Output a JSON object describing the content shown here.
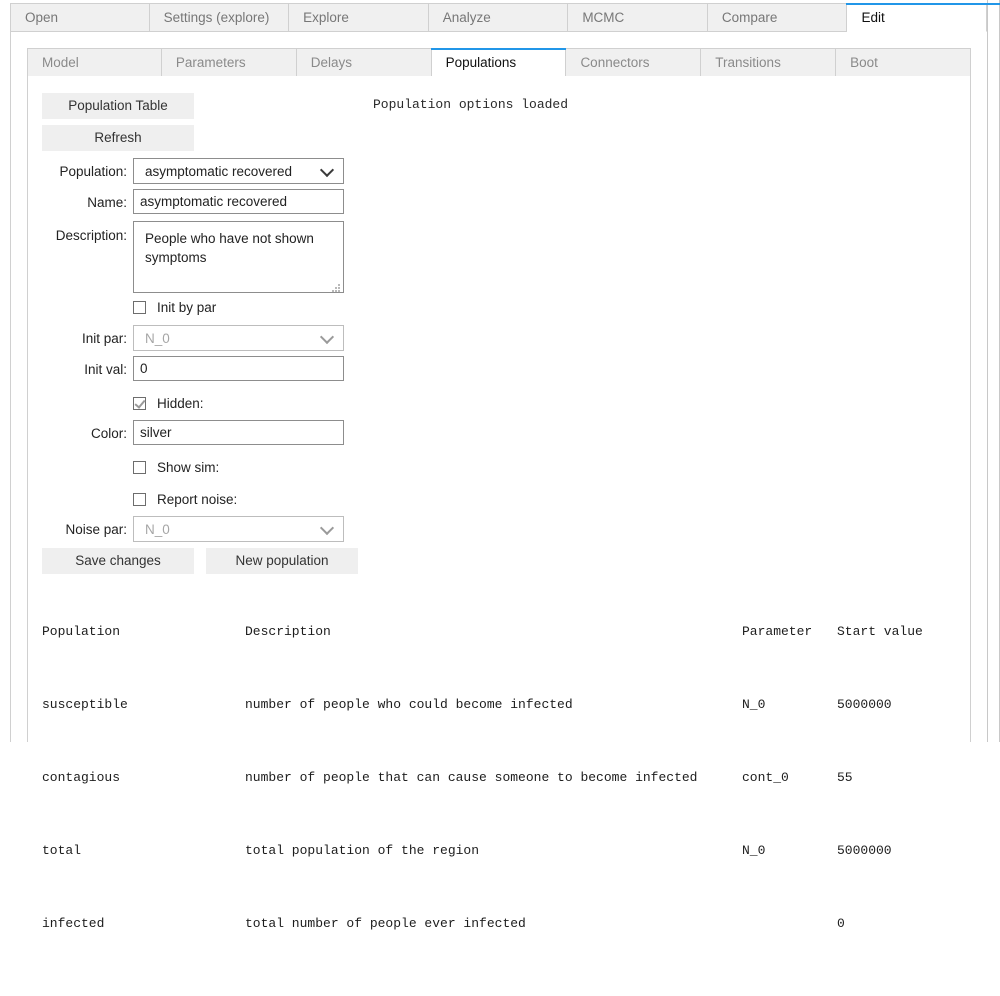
{
  "window": {
    "accent_color": "#2196e8",
    "tab_bg": "#f0f0f0",
    "button_bg": "#efefef"
  },
  "outer_tabs": [
    {
      "label": "Open",
      "active": false
    },
    {
      "label": "Settings (explore)",
      "active": false
    },
    {
      "label": "Explore",
      "active": false
    },
    {
      "label": "Analyze",
      "active": false
    },
    {
      "label": "MCMC",
      "active": false
    },
    {
      "label": "Compare",
      "active": false
    },
    {
      "label": "Edit",
      "active": true
    }
  ],
  "inner_tabs": [
    {
      "label": "Model",
      "active": false
    },
    {
      "label": "Parameters",
      "active": false
    },
    {
      "label": "Delays",
      "active": false
    },
    {
      "label": "Populations",
      "active": true
    },
    {
      "label": "Connectors",
      "active": false
    },
    {
      "label": "Transitions",
      "active": false
    },
    {
      "label": "Boot",
      "active": false
    }
  ],
  "status": {
    "message": "Population options loaded"
  },
  "form": {
    "population_table_button": "Population Table",
    "refresh_button": "Refresh",
    "population_label": "Population:",
    "population_value": "asymptomatic recovered",
    "name_label": "Name:",
    "name_value": "asymptomatic recovered",
    "description_label": "Description:",
    "description_value": "People who have not shown symptoms",
    "init_by_par_label": "Init by par",
    "init_by_par_checked": false,
    "init_par_label": "Init par:",
    "init_par_value": "N_0",
    "init_par_disabled": true,
    "init_val_label": "Init val:",
    "init_val_value": "0",
    "hidden_label": "Hidden:",
    "hidden_checked": true,
    "color_label": "Color:",
    "color_value": "silver",
    "show_sim_label": "Show sim:",
    "show_sim_checked": false,
    "report_noise_label": "Report noise:",
    "report_noise_checked": false,
    "noise_par_label": "Noise par:",
    "noise_par_value": "N_0",
    "noise_par_disabled": true,
    "save_changes_button": "Save changes",
    "new_population_button": "New population"
  },
  "table": {
    "headers": {
      "population": "Population",
      "description": "Description",
      "parameter": "Parameter",
      "start_value": "Start value"
    },
    "double_rule": "================================================================================================================",
    "single_rule": "----------------------------------------------------------------------------------------------------------------",
    "rows": [
      {
        "population": "susceptible",
        "description": "number of people who could become infected",
        "parameter": "N_0",
        "start_value": "5000000"
      },
      {
        "population": "contagious",
        "description": "number of people that can cause someone to become infected",
        "parameter": "cont_0",
        "start_value": "55"
      },
      {
        "population": "total",
        "description": "total population of the region",
        "parameter": "N_0",
        "start_value": "5000000"
      },
      {
        "population": "infected",
        "description": "total number of people ever infected",
        "parameter": "",
        "start_value": "0"
      }
    ]
  }
}
